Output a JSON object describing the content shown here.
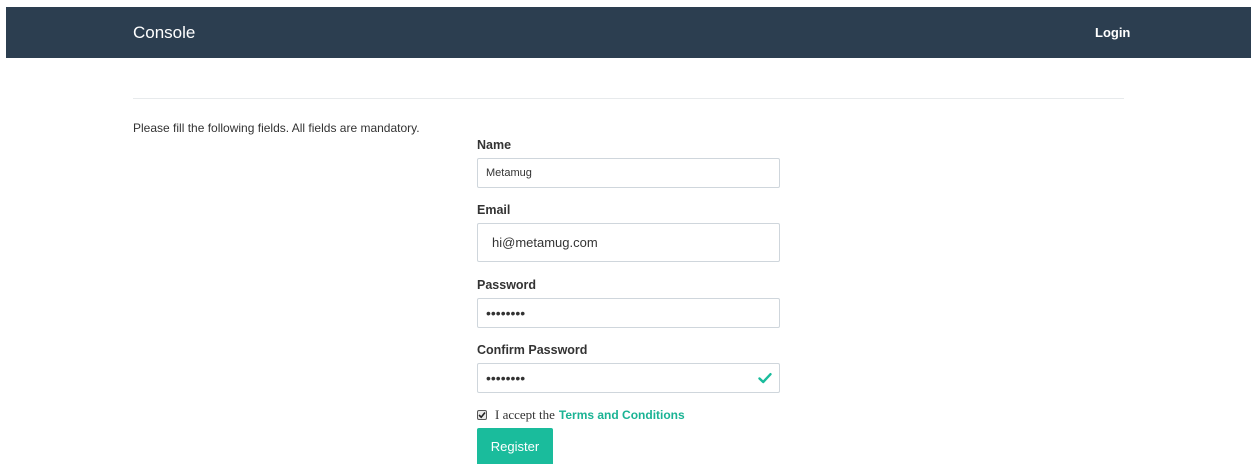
{
  "navbar": {
    "brand": "Console",
    "login_label": "Login"
  },
  "form": {
    "instructions": "Please fill the following fields. All fields are mandatory.",
    "name": {
      "label": "Name",
      "value": "Metamug"
    },
    "email": {
      "label": "Email",
      "value": "hi@metamug.com"
    },
    "password": {
      "label": "Password",
      "value": "••••••••"
    },
    "confirm_password": {
      "label": "Confirm Password",
      "value": "••••••••",
      "valid": true
    },
    "terms": {
      "checked": true,
      "text": "I accept the",
      "link_label": "Terms and Conditions"
    },
    "register_label": "Register"
  },
  "icons": {
    "valid": "check-icon",
    "checkbox": "checkbox-checked-icon"
  },
  "colors": {
    "navbar_bg": "#2c3e50",
    "accent": "#1abc9c",
    "link": "#1ab394"
  }
}
